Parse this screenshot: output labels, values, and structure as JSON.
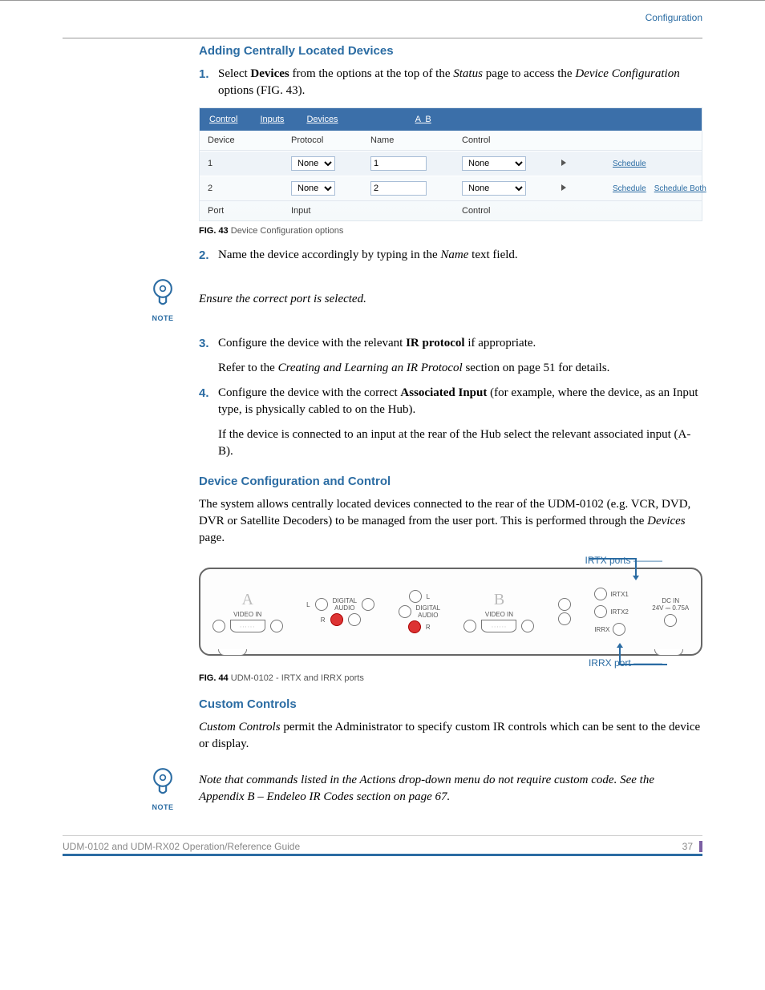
{
  "chapter": "Configuration",
  "h2_adding": "Adding Centrally Located Devices",
  "step1_pre": "Select ",
  "step1_bold": "Devices",
  "step1_mid": " from the options at the top of the ",
  "step1_it1": "Status",
  "step1_mid2": " page to access the ",
  "step1_it2": "Device Configuration",
  "step1_post": " options (FIG. 43).",
  "fig43": {
    "tabs": {
      "control": "Control",
      "inputs": "Inputs",
      "devices": "Devices",
      "ab": "A  B"
    },
    "hdr": {
      "device": "Device",
      "protocol": "Protocol",
      "name": "Name",
      "control": "Control"
    },
    "rows": [
      {
        "id": "1",
        "protocol": "None",
        "name": "1",
        "control": "None",
        "sched": "Schedule"
      },
      {
        "id": "2",
        "protocol": "None",
        "name": "2",
        "control": "None",
        "sched": "Schedule",
        "sched2": "Schedule Both"
      }
    ],
    "foot": {
      "port": "Port",
      "input": "Input",
      "control": "Control"
    }
  },
  "fig43_cap_b": "FIG. 43",
  "fig43_cap": "  Device Configuration options",
  "step2_pre": "Name the device accordingly by typing in the ",
  "step2_it": "Name",
  "step2_post": " text field.",
  "note1": "Ensure the correct port is selected.",
  "note_label": "NOTE",
  "step3_pre": "Configure the device with the relevant ",
  "step3_bold": "IR protocol",
  "step3_post": " if appropriate.",
  "step3_refer_pre": "Refer to the ",
  "step3_refer_it": "Creating and Learning an IR Protocol",
  "step3_refer_post": " section on page 51 for details.",
  "step4_pre": "Configure the device with the correct ",
  "step4_bold": "Associated Input",
  "step4_post": " (for example, where the device, as an Input type, is physically cabled to on the Hub).",
  "step4_sub": "If the device is connected to an input at the rear of the Hub select the relevant associated input (A-B).",
  "h2_dcc": "Device Configuration and Control",
  "dcc_p_pre": "The system allows centrally located devices connected to the rear of the UDM-0102 (e.g. VCR, DVD, DVR or Satellite Decoders) to be managed from the user port. This is performed through the ",
  "dcc_p_it": "Devices",
  "dcc_p_post": " page.",
  "fig44": {
    "top_label": "IRTX ports",
    "bot_label": "IRRX port",
    "A": "A",
    "B": "B",
    "videoin": "VIDEO IN",
    "digaudio": "DIGITAL\nAUDIO",
    "L": "L",
    "R": "R",
    "irtx1": "IRTX1",
    "irtx2": "IRTX2",
    "irrx": "IRRX",
    "dcin": "DC IN\n24V ⎓ 0.75A"
  },
  "fig44_cap_b": "FIG. 44",
  "fig44_cap": "   UDM-0102 - IRTX and IRRX ports",
  "h2_cc": "Custom Controls",
  "cc_p_it": "Custom Controls",
  "cc_p_post": " permit the Administrator to specify custom IR controls which can be sent to the device or display.",
  "note2_a": "Note that commands listed in the Actions drop-down menu do not require custom code. See the ",
  "note2_b": "Appendix B – Endeleo IR Codes",
  "note2_c": " section on page 67.",
  "footer_left": "UDM-0102 and UDM-RX02 Operation/Reference Guide",
  "footer_right": "37",
  "nums": {
    "n1": "1.",
    "n2": "2.",
    "n3": "3.",
    "n4": "4."
  }
}
